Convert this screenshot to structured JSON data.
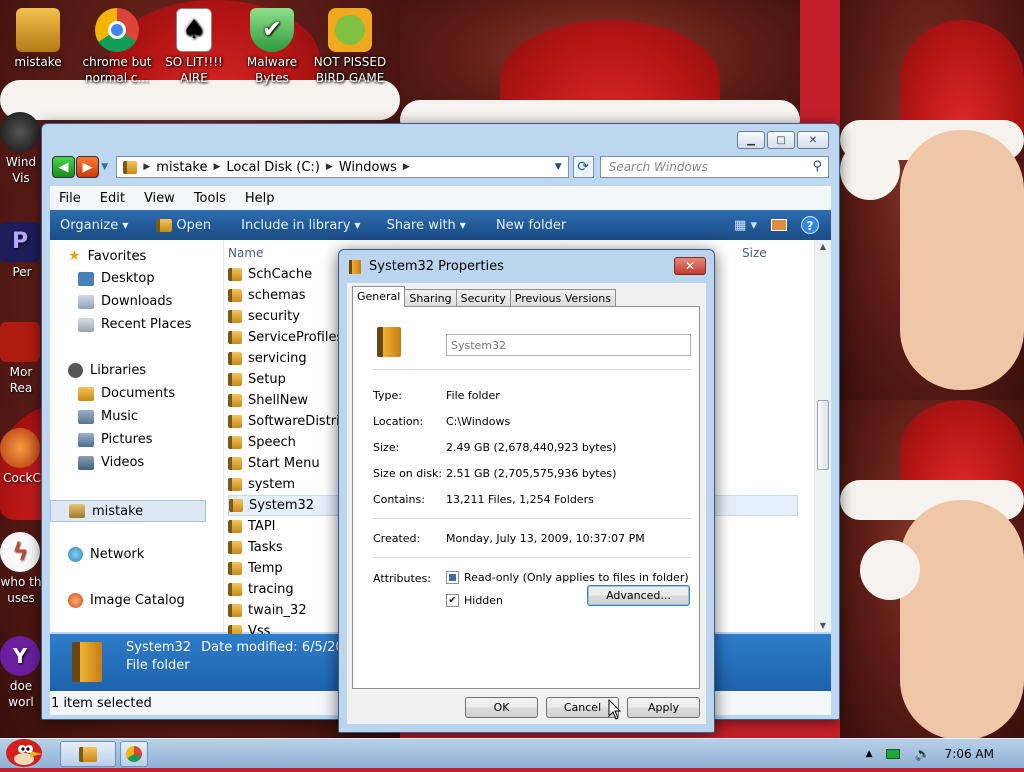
{
  "desktop": {
    "icons": [
      {
        "label": "mistake",
        "icon": "computer-user-icon"
      },
      {
        "label": "chrome but normal c...",
        "icon": "chrome-icon"
      },
      {
        "label": "SO LIT!!!! AIRE",
        "icon": "solitaire-icon"
      },
      {
        "label": "Malware Bytes",
        "icon": "shield-icon"
      },
      {
        "label": "NOT PISSED BIRD GAME",
        "icon": "green-pig-icon"
      }
    ],
    "left_icons": [
      {
        "label": "Wind Vis",
        "icon": "windows-icon"
      },
      {
        "label": "Per",
        "icon": "premiere-icon"
      },
      {
        "label": "Mor Rea",
        "icon": "pdf-icon"
      },
      {
        "label": "CockC",
        "icon": "app-icon"
      },
      {
        "label": "who th uses",
        "icon": "flash-icon"
      },
      {
        "label": "doe worl",
        "icon": "yahoo-icon"
      }
    ]
  },
  "explorer": {
    "breadcrumb": [
      "mistake",
      "Local Disk (C:)",
      "Windows"
    ],
    "search_placeholder": "Search Windows",
    "menu": [
      "File",
      "Edit",
      "View",
      "Tools",
      "Help"
    ],
    "commands": {
      "organize": "Organize",
      "open": "Open",
      "include": "Include in library",
      "share": "Share with",
      "new_folder": "New folder"
    },
    "nav": {
      "favorites": "Favorites",
      "desktop": "Desktop",
      "downloads": "Downloads",
      "recent": "Recent Places",
      "libraries": "Libraries",
      "documents": "Documents",
      "music": "Music",
      "pictures": "Pictures",
      "videos": "Videos",
      "user": "mistake",
      "network": "Network",
      "image_catalog": "Image Catalog"
    },
    "columns": {
      "name": "Name",
      "size": "Size"
    },
    "files": [
      "SchCache",
      "schemas",
      "security",
      "ServiceProfiles",
      "servicing",
      "Setup",
      "ShellNew",
      "SoftwareDistribution",
      "Speech",
      "Start Menu",
      "system",
      "System32",
      "TAPI",
      "Tasks",
      "Temp",
      "tracing",
      "twain_32",
      "Vss"
    ],
    "selected_file": "System32",
    "details": {
      "name": "System32",
      "modified_label": "Date modified:",
      "modified_value": "6/5/2022",
      "type": "File folder"
    },
    "status": "1 item selected"
  },
  "dialog": {
    "title": "System32 Properties",
    "tabs": [
      "General",
      "Sharing",
      "Security",
      "Previous Versions"
    ],
    "name_value": "System32",
    "props": {
      "type_label": "Type:",
      "type_value": "File folder",
      "location_label": "Location:",
      "location_value": "C:\\Windows",
      "size_label": "Size:",
      "size_value": "2.49 GB (2,678,440,923 bytes)",
      "size_on_disk_label": "Size on disk:",
      "size_on_disk_value": "2.51 GB (2,705,575,936 bytes)",
      "contains_label": "Contains:",
      "contains_value": "13,211 Files, 1,254 Folders",
      "created_label": "Created:",
      "created_value": "Monday, July 13, 2009, 10:37:07 PM",
      "attributes_label": "Attributes:",
      "readonly_label": "Read-only (Only applies to files in folder)",
      "hidden_label": "Hidden",
      "hidden_checked": true,
      "advanced_label": "Advanced..."
    },
    "buttons": {
      "ok": "OK",
      "cancel": "Cancel",
      "apply": "Apply"
    }
  },
  "taskbar": {
    "clock": "7:06 AM"
  },
  "colors": {
    "command_bar": "#225a98",
    "details_pane": "#2f7dca",
    "window_frame": "#bcd7ef"
  }
}
